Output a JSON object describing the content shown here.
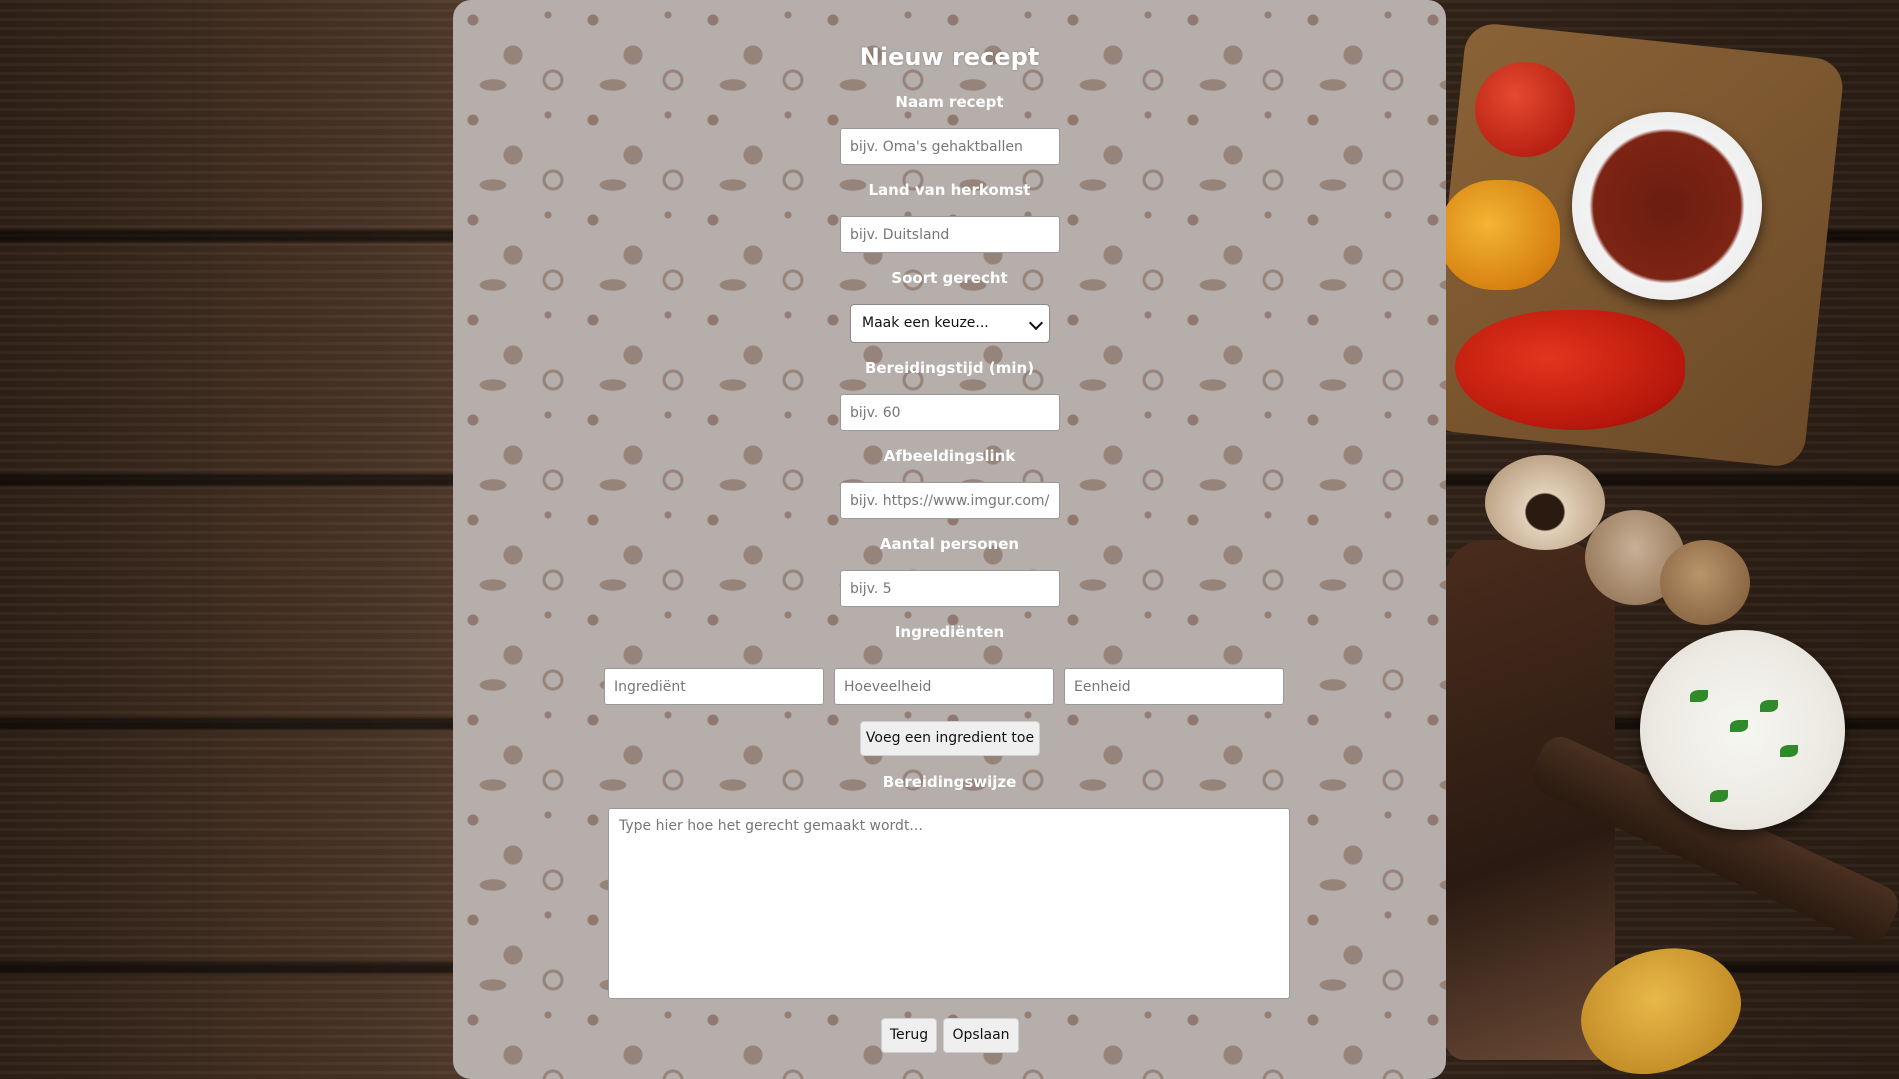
{
  "form": {
    "title": "Nieuw recept",
    "name": {
      "label": "Naam recept",
      "placeholder": "bijv. Oma's gehaktballen",
      "value": ""
    },
    "country": {
      "label": "Land van herkomst",
      "placeholder": "bijv. Duitsland",
      "value": ""
    },
    "dish_type": {
      "label": "Soort gerecht",
      "selected": "Maak een keuze..."
    },
    "prep_time": {
      "label": "Bereidingstijd (min)",
      "placeholder": "bijv. 60",
      "value": ""
    },
    "image_link": {
      "label": "Afbeeldingslink",
      "placeholder": "bijv. https://www.imgur.com/",
      "value": ""
    },
    "persons": {
      "label": "Aantal personen",
      "placeholder": "bijv. 5",
      "value": ""
    },
    "ingredients": {
      "label": "Ingrediënten",
      "ingredient_placeholder": "Ingrediënt",
      "amount_placeholder": "Hoeveelheid",
      "unit_placeholder": "Eenheid",
      "add_button": "Voeg een ingredient toe"
    },
    "method": {
      "label": "Bereidingswijze",
      "placeholder": "Type hier hoe het gerecht gemaakt wordt..."
    },
    "buttons": {
      "back": "Terug",
      "save": "Opslaan"
    }
  },
  "colors": {
    "panel_bg": "#b5aeaa",
    "pattern": "#704e40",
    "label_text": "#ffffff"
  }
}
